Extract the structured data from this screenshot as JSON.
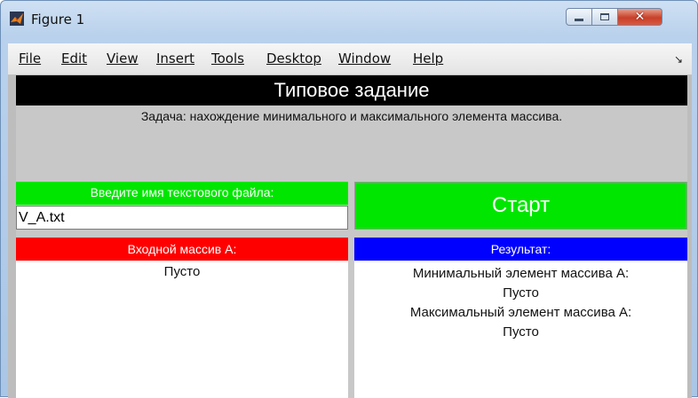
{
  "window": {
    "title": "Figure 1",
    "buttons": {
      "minimize": "minimize",
      "maximize": "maximize",
      "close": "✕"
    }
  },
  "menu": [
    "File",
    "Edit",
    "View",
    "Insert",
    "Tools",
    "Desktop",
    "Window",
    "Help"
  ],
  "menu_dock_icon": "↘",
  "header": {
    "title": "Типовое задание",
    "task": "Задача: нахождение минимального и максимального элемента массива."
  },
  "file_input": {
    "label": "Введите имя текстового файла:",
    "value": "V_A.txt"
  },
  "start_button": {
    "label": "Старт"
  },
  "input_array": {
    "label": "Входной массив А:",
    "content": "Пусто"
  },
  "result": {
    "label": "Результат:",
    "min_label": "Минимальный элемент массива А:",
    "min_value": "Пусто",
    "max_label": "Максимальный элемент массива А:",
    "max_value": "Пусто"
  },
  "colors": {
    "green": "#00e600",
    "red": "#ff0000",
    "blue": "#0000ff",
    "header_bg": "#000000",
    "panel_bg": "#c8c8c8"
  }
}
